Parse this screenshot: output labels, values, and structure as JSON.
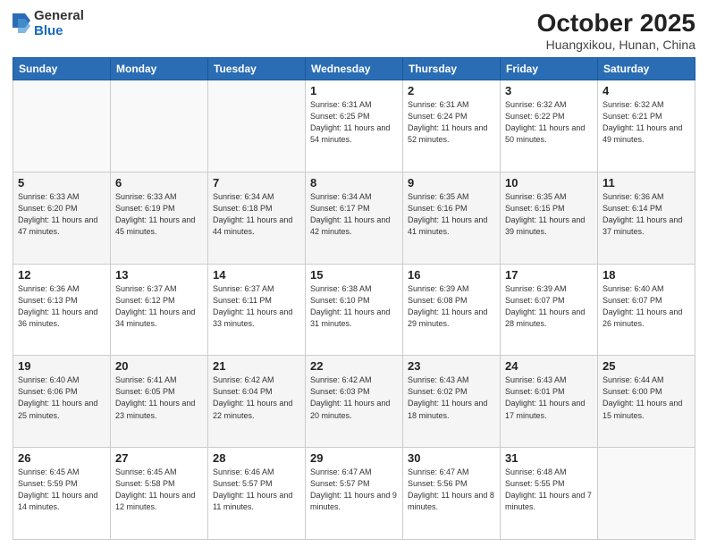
{
  "logo": {
    "general": "General",
    "blue": "Blue"
  },
  "header": {
    "month": "October 2025",
    "location": "Huangxikou, Hunan, China"
  },
  "weekdays": [
    "Sunday",
    "Monday",
    "Tuesday",
    "Wednesday",
    "Thursday",
    "Friday",
    "Saturday"
  ],
  "weeks": [
    [
      {
        "day": "",
        "info": ""
      },
      {
        "day": "",
        "info": ""
      },
      {
        "day": "",
        "info": ""
      },
      {
        "day": "1",
        "info": "Sunrise: 6:31 AM\nSunset: 6:25 PM\nDaylight: 11 hours\nand 54 minutes."
      },
      {
        "day": "2",
        "info": "Sunrise: 6:31 AM\nSunset: 6:24 PM\nDaylight: 11 hours\nand 52 minutes."
      },
      {
        "day": "3",
        "info": "Sunrise: 6:32 AM\nSunset: 6:22 PM\nDaylight: 11 hours\nand 50 minutes."
      },
      {
        "day": "4",
        "info": "Sunrise: 6:32 AM\nSunset: 6:21 PM\nDaylight: 11 hours\nand 49 minutes."
      }
    ],
    [
      {
        "day": "5",
        "info": "Sunrise: 6:33 AM\nSunset: 6:20 PM\nDaylight: 11 hours\nand 47 minutes."
      },
      {
        "day": "6",
        "info": "Sunrise: 6:33 AM\nSunset: 6:19 PM\nDaylight: 11 hours\nand 45 minutes."
      },
      {
        "day": "7",
        "info": "Sunrise: 6:34 AM\nSunset: 6:18 PM\nDaylight: 11 hours\nand 44 minutes."
      },
      {
        "day": "8",
        "info": "Sunrise: 6:34 AM\nSunset: 6:17 PM\nDaylight: 11 hours\nand 42 minutes."
      },
      {
        "day": "9",
        "info": "Sunrise: 6:35 AM\nSunset: 6:16 PM\nDaylight: 11 hours\nand 41 minutes."
      },
      {
        "day": "10",
        "info": "Sunrise: 6:35 AM\nSunset: 6:15 PM\nDaylight: 11 hours\nand 39 minutes."
      },
      {
        "day": "11",
        "info": "Sunrise: 6:36 AM\nSunset: 6:14 PM\nDaylight: 11 hours\nand 37 minutes."
      }
    ],
    [
      {
        "day": "12",
        "info": "Sunrise: 6:36 AM\nSunset: 6:13 PM\nDaylight: 11 hours\nand 36 minutes."
      },
      {
        "day": "13",
        "info": "Sunrise: 6:37 AM\nSunset: 6:12 PM\nDaylight: 11 hours\nand 34 minutes."
      },
      {
        "day": "14",
        "info": "Sunrise: 6:37 AM\nSunset: 6:11 PM\nDaylight: 11 hours\nand 33 minutes."
      },
      {
        "day": "15",
        "info": "Sunrise: 6:38 AM\nSunset: 6:10 PM\nDaylight: 11 hours\nand 31 minutes."
      },
      {
        "day": "16",
        "info": "Sunrise: 6:39 AM\nSunset: 6:08 PM\nDaylight: 11 hours\nand 29 minutes."
      },
      {
        "day": "17",
        "info": "Sunrise: 6:39 AM\nSunset: 6:07 PM\nDaylight: 11 hours\nand 28 minutes."
      },
      {
        "day": "18",
        "info": "Sunrise: 6:40 AM\nSunset: 6:07 PM\nDaylight: 11 hours\nand 26 minutes."
      }
    ],
    [
      {
        "day": "19",
        "info": "Sunrise: 6:40 AM\nSunset: 6:06 PM\nDaylight: 11 hours\nand 25 minutes."
      },
      {
        "day": "20",
        "info": "Sunrise: 6:41 AM\nSunset: 6:05 PM\nDaylight: 11 hours\nand 23 minutes."
      },
      {
        "day": "21",
        "info": "Sunrise: 6:42 AM\nSunset: 6:04 PM\nDaylight: 11 hours\nand 22 minutes."
      },
      {
        "day": "22",
        "info": "Sunrise: 6:42 AM\nSunset: 6:03 PM\nDaylight: 11 hours\nand 20 minutes."
      },
      {
        "day": "23",
        "info": "Sunrise: 6:43 AM\nSunset: 6:02 PM\nDaylight: 11 hours\nand 18 minutes."
      },
      {
        "day": "24",
        "info": "Sunrise: 6:43 AM\nSunset: 6:01 PM\nDaylight: 11 hours\nand 17 minutes."
      },
      {
        "day": "25",
        "info": "Sunrise: 6:44 AM\nSunset: 6:00 PM\nDaylight: 11 hours\nand 15 minutes."
      }
    ],
    [
      {
        "day": "26",
        "info": "Sunrise: 6:45 AM\nSunset: 5:59 PM\nDaylight: 11 hours\nand 14 minutes."
      },
      {
        "day": "27",
        "info": "Sunrise: 6:45 AM\nSunset: 5:58 PM\nDaylight: 11 hours\nand 12 minutes."
      },
      {
        "day": "28",
        "info": "Sunrise: 6:46 AM\nSunset: 5:57 PM\nDaylight: 11 hours\nand 11 minutes."
      },
      {
        "day": "29",
        "info": "Sunrise: 6:47 AM\nSunset: 5:57 PM\nDaylight: 11 hours\nand 9 minutes."
      },
      {
        "day": "30",
        "info": "Sunrise: 6:47 AM\nSunset: 5:56 PM\nDaylight: 11 hours\nand 8 minutes."
      },
      {
        "day": "31",
        "info": "Sunrise: 6:48 AM\nSunset: 5:55 PM\nDaylight: 11 hours\nand 7 minutes."
      },
      {
        "day": "",
        "info": ""
      }
    ]
  ]
}
